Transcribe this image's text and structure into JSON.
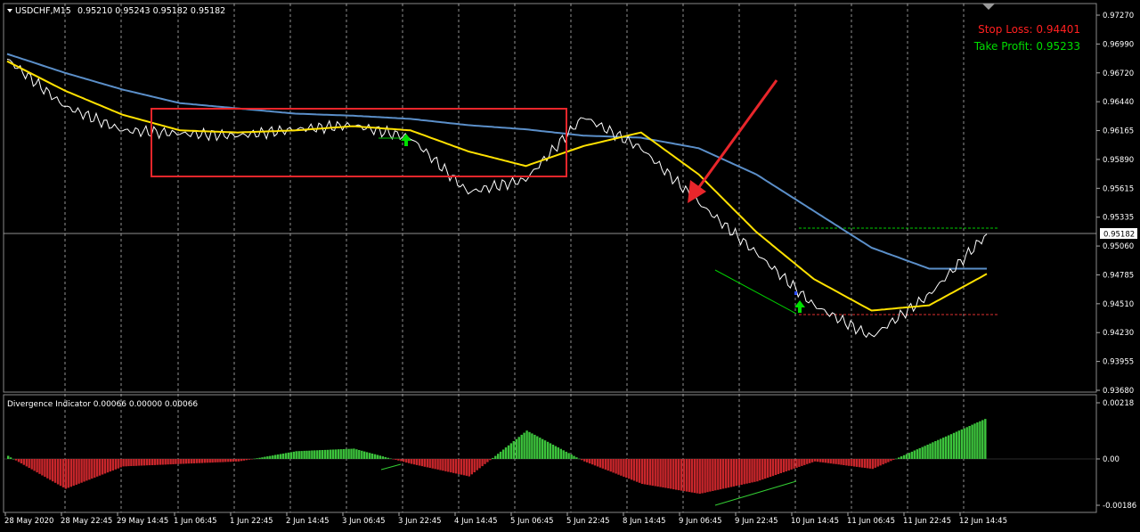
{
  "window": {
    "symbol_label": "USDCHF,M15",
    "ohlc_label": "0.95210 0.95243 0.95182 0.95182",
    "menu_icon": "triangle-down-icon"
  },
  "main_panel": {
    "stop_loss_label": "Stop Loss: 0.94401",
    "take_profit_label": "Take Profit: 0.95233",
    "stop_loss_color": "#ff2020",
    "take_profit_color": "#00dd00",
    "current_price_label": "0.95182",
    "price_ticks": [
      "0.97270",
      "0.96990",
      "0.96720",
      "0.96440",
      "0.96165",
      "0.95890",
      "0.95615",
      "0.95335",
      "0.95060",
      "0.94785",
      "0.94510",
      "0.94230",
      "0.93955",
      "0.93680"
    ],
    "colors": {
      "price": "#ffffff",
      "ma_fast": "#ffe100",
      "ma_slow": "#5b8fc9",
      "box": "#e8262b",
      "arrow": "#e8262b",
      "buy_arrow": "#00e000",
      "divergence_line": "#00cc00"
    }
  },
  "indicator_panel": {
    "title": "Divergence Indicator 0.00066 0.00000 0.00066",
    "ticks": [
      "0.00218",
      "0.00",
      "-0.00186"
    ],
    "colors": {
      "positive": "#3cc33c",
      "negative": "#c8262b",
      "divergence_line": "#33cc33"
    }
  },
  "time_axis": {
    "labels": [
      "28 May 2020",
      "28 May 22:45",
      "29 May 14:45",
      "1 Jun 06:45",
      "1 Jun 22:45",
      "2 Jun 14:45",
      "3 Jun 06:45",
      "3 Jun 22:45",
      "4 Jun 14:45",
      "5 Jun 06:45",
      "5 Jun 22:45",
      "8 Jun 14:45",
      "9 Jun 06:45",
      "9 Jun 22:45",
      "10 Jun 14:45",
      "11 Jun 06:45",
      "11 Jun 22:45",
      "12 Jun 14:45"
    ]
  },
  "chart_data": [
    {
      "type": "line",
      "title": "USDCHF,M15",
      "x": [
        "28 May 2020",
        "28 May 22:45",
        "29 May 14:45",
        "1 Jun 06:45",
        "1 Jun 22:45",
        "2 Jun 14:45",
        "3 Jun 06:45",
        "3 Jun 22:45",
        "4 Jun 14:45",
        "5 Jun 06:45",
        "5 Jun 22:45",
        "8 Jun 14:45",
        "9 Jun 06:45",
        "9 Jun 22:45",
        "10 Jun 14:45",
        "11 Jun 06:45",
        "11 Jun 22:45",
        "12 Jun 14:45"
      ],
      "ylim": [
        0.9368,
        0.9727
      ],
      "series": [
        {
          "name": "USDCHF",
          "values": [
            0.9685,
            0.964,
            0.9617,
            0.9614,
            0.9612,
            0.9618,
            0.9622,
            0.961,
            0.9558,
            0.957,
            0.963,
            0.96,
            0.9548,
            0.95,
            0.945,
            0.942,
            0.946,
            0.9518
          ]
        },
        {
          "values": [
            0.9683,
            0.9655,
            0.9632,
            0.9617,
            0.9615,
            0.9617,
            0.9621,
            0.9617,
            0.9597,
            0.9583,
            0.9602,
            0.9615,
            0.9575,
            0.952,
            0.9475,
            0.9445,
            0.945,
            0.948
          ]
        },
        {
          "values": [
            0.969,
            0.9672,
            0.9656,
            0.9643,
            0.9638,
            0.9633,
            0.9631,
            0.9628,
            0.9622,
            0.9618,
            0.9612,
            0.961,
            0.96,
            0.9575,
            0.954,
            0.9505,
            0.9485,
            0.9485
          ]
        }
      ],
      "annotations": [
        "Stop Loss: 0.94401",
        "Take Profit: 0.95233",
        "0.95182"
      ]
    },
    {
      "type": "bar",
      "title": "Divergence Indicator 0.00066 0.00000 0.00066",
      "x": [
        "28 May 2020",
        "28 May 22:45",
        "29 May 14:45",
        "1 Jun 06:45",
        "1 Jun 22:45",
        "2 Jun 14:45",
        "3 Jun 06:45",
        "3 Jun 22:45",
        "4 Jun 14:45",
        "5 Jun 06:45",
        "5 Jun 22:45",
        "8 Jun 14:45",
        "9 Jun 06:45",
        "9 Jun 22:45",
        "10 Jun 14:45",
        "11 Jun 06:45",
        "11 Jun 22:45",
        "12 Jun 14:45"
      ],
      "ylim": [
        -0.00186,
        0.00218
      ],
      "series": [
        {
          "values": [
            0.00012,
            -0.0012,
            -0.0003,
            -0.0002,
            -0.0001,
            0.0003,
            0.0004,
            -0.0002,
            -0.0007,
            0.0011,
            -0.0001,
            -0.001,
            -0.0014,
            -0.0009,
            -0.0001,
            -0.0004,
            0.0006,
            0.0016
          ]
        }
      ]
    }
  ]
}
